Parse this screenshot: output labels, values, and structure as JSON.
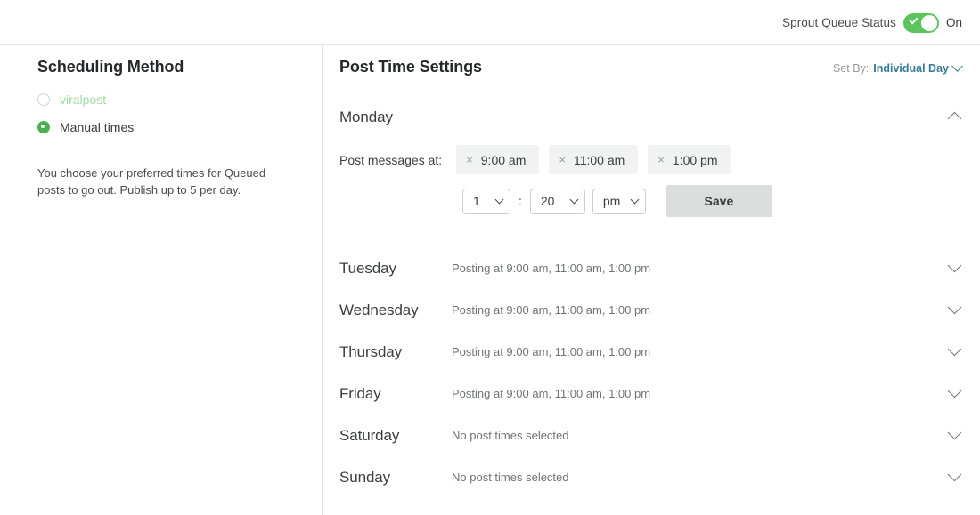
{
  "topbar": {
    "queue_status_label": "Sprout Queue Status",
    "toggle_state": "On",
    "toggle_on": true,
    "toggle_color": "#5cc45c"
  },
  "scheduling_method": {
    "title": "Scheduling Method",
    "options": [
      {
        "label": "viralpost",
        "selected": false,
        "disabled": true
      },
      {
        "label": "Manual times",
        "selected": true,
        "disabled": false
      }
    ],
    "help_text": "You choose your preferred times for Queued posts to go out. Publish up to 5 per day."
  },
  "post_time_settings": {
    "title": "Post Time Settings",
    "set_by": {
      "label": "Set By:",
      "value": "Individual Day",
      "link_color": "#337d96"
    },
    "expanded_day": {
      "name": "Monday",
      "times_label": "Post messages at:",
      "chips": [
        {
          "remove": "×",
          "time": "9:00 am"
        },
        {
          "remove": "×",
          "time": "11:00 am"
        },
        {
          "remove": "×",
          "time": "1:00 pm"
        }
      ],
      "picker": {
        "hour": "1",
        "separator": ":",
        "minute": "20",
        "meridiem": "pm",
        "save_label": "Save"
      }
    },
    "days": [
      {
        "name": "Tuesday",
        "summary": "Posting at 9:00 am, 11:00 am, 1:00 pm"
      },
      {
        "name": "Wednesday",
        "summary": "Posting at 9:00 am, 11:00 am, 1:00 pm"
      },
      {
        "name": "Thursday",
        "summary": "Posting at 9:00 am, 11:00 am, 1:00 pm"
      },
      {
        "name": "Friday",
        "summary": "Posting at 9:00 am, 11:00 am, 1:00 pm"
      },
      {
        "name": "Saturday",
        "summary": "No post times selected"
      },
      {
        "name": "Sunday",
        "summary": "No post times selected"
      }
    ]
  }
}
